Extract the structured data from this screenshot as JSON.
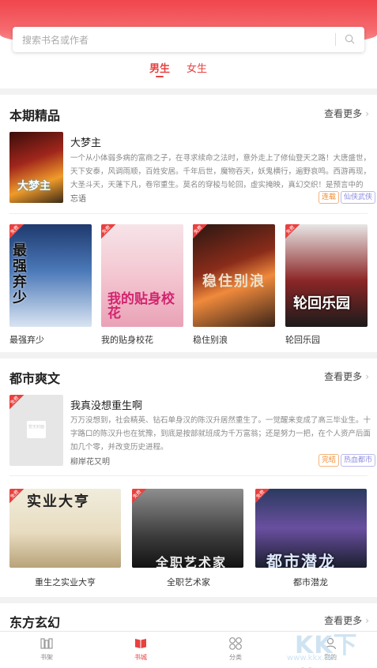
{
  "search": {
    "placeholder": "搜索书名或作者"
  },
  "gender_tabs": [
    {
      "label": "男生",
      "active": true
    },
    {
      "label": "女生",
      "active": false
    }
  ],
  "sections": [
    {
      "title": "本期精品",
      "more": "查看更多",
      "featured": {
        "title": "大梦主",
        "desc": "一个从小体弱多病的富商之子，在寻求续命之法时，意外走上了修仙登天之路！大唐盛世，天下安泰，风调雨顺，百姓安居。千年后世，魔物吞天，妖鬼横行，遍野哀鸣。西游再现，大圣斗天，天蓬下凡，卷帘重生。莫名的穿梭与轮回，虚实掩映，真幻交织！是预言中的梦…",
        "author": "忘语",
        "tags": [
          "连载",
          "仙侠武侠"
        ],
        "cover_text": "大梦主"
      },
      "books": [
        {
          "title": "最强弃少",
          "cover_text": "最强弃少"
        },
        {
          "title": "我的贴身校花",
          "cover_text": "我的贴身校花"
        },
        {
          "title": "稳住别浪",
          "cover_text": "稳住别浪"
        },
        {
          "title": "轮回乐园",
          "cover_text": "轮回乐园"
        }
      ]
    },
    {
      "title": "都市爽文",
      "more": "查看更多",
      "featured": {
        "title": "我真没想重生啊",
        "desc": "万万没想到，社会精英、钻石单身汉的陈汉升居然重生了。一觉醒来变成了高三毕业生。十字路口的陈汉升也在犹豫，到底是按部就班成为千万富翁；还是努力一把，在个人资产后面加几个零，并改变历史进程。",
        "author": "柳岸花又明",
        "tags": [
          "完结",
          "热血都市"
        ],
        "cover_text": "暂无封面"
      },
      "books": [
        {
          "title": "重生之实业大亨",
          "cover_text": "实业大亨"
        },
        {
          "title": "全职艺术家",
          "cover_text": "全职艺术家"
        },
        {
          "title": "都市潜龙",
          "cover_text": "都市潜龙"
        }
      ]
    },
    {
      "title": "东方玄幻",
      "more": "查看更多"
    }
  ],
  "free_badge": "免费",
  "bottom_tabs": [
    {
      "label": "书架",
      "active": false,
      "icon": "bookshelf-icon"
    },
    {
      "label": "书城",
      "active": true,
      "icon": "bookstore-icon"
    },
    {
      "label": "分类",
      "active": false,
      "icon": "category-icon"
    },
    {
      "label": "我的",
      "active": false,
      "icon": "profile-icon"
    }
  ],
  "watermark": {
    "text": "KK下载",
    "url": "www.kkx.net"
  },
  "colors": {
    "accent": "#e8413f",
    "header": "#f0454c"
  }
}
